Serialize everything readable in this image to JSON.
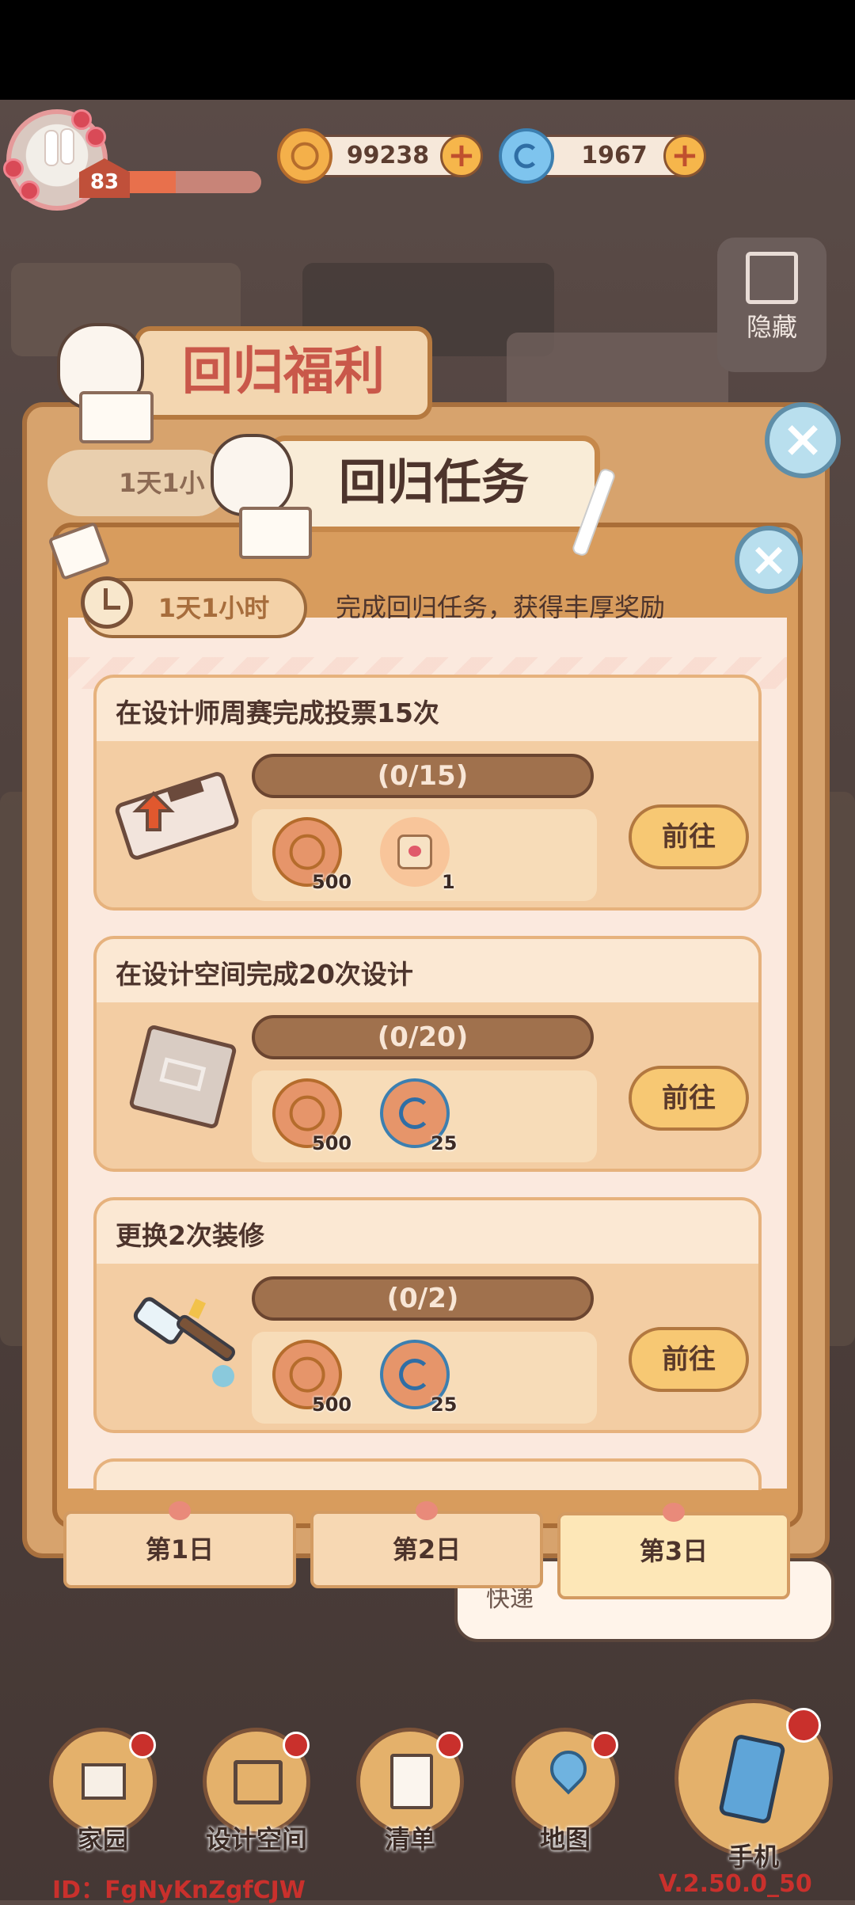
{
  "player": {
    "level": "83",
    "xp_fraction": 0.4
  },
  "currencies": [
    {
      "name": "coin-icon",
      "value": "99238"
    },
    {
      "name": "gem-icon",
      "value": "1967"
    }
  ],
  "side": {
    "hide_label": "隐藏"
  },
  "back_panel": {
    "title": "回归福利",
    "timer": "1天1小"
  },
  "panel": {
    "title": "回归任务",
    "timer": "1天1小时",
    "description": "完成回归任务，获得丰厚奖励"
  },
  "tasks": [
    {
      "title": "在设计师周赛完成投票15次",
      "progress": "(0/15)",
      "icon": "ticket-icon",
      "rewards": [
        {
          "icon": "coin-icon",
          "amount": "500"
        },
        {
          "icon": "paw-card-icon",
          "amount": "1"
        }
      ],
      "button": "前往"
    },
    {
      "title": "在设计空间完成20次设计",
      "progress": "(0/20)",
      "icon": "blueprint-icon",
      "rewards": [
        {
          "icon": "coin-icon",
          "amount": "500"
        },
        {
          "icon": "gem-icon",
          "amount": "25"
        }
      ],
      "button": "前往"
    },
    {
      "title": "更换2次装修",
      "progress": "(0/2)",
      "icon": "paintbrush-icon",
      "rewards": [
        {
          "icon": "coin-icon",
          "amount": "500"
        },
        {
          "icon": "gem-icon",
          "amount": "25"
        }
      ],
      "button": "前往"
    }
  ],
  "day_tabs": [
    "第1日",
    "第2日",
    "第3日"
  ],
  "active_tab": "第3日",
  "chat_bubble": "快递",
  "bottom_nav": [
    "家园",
    "设计空间",
    "清单",
    "地图",
    "手机"
  ],
  "footer": {
    "id": "ID：FgNyKnZgfCJW",
    "version": "V.2.50.0_50"
  },
  "colors": {
    "accent": "#d89c5d",
    "badge_red": "#c9302c",
    "gem_blue": "#7ec4ee",
    "coin_gold": "#f4b04a"
  }
}
